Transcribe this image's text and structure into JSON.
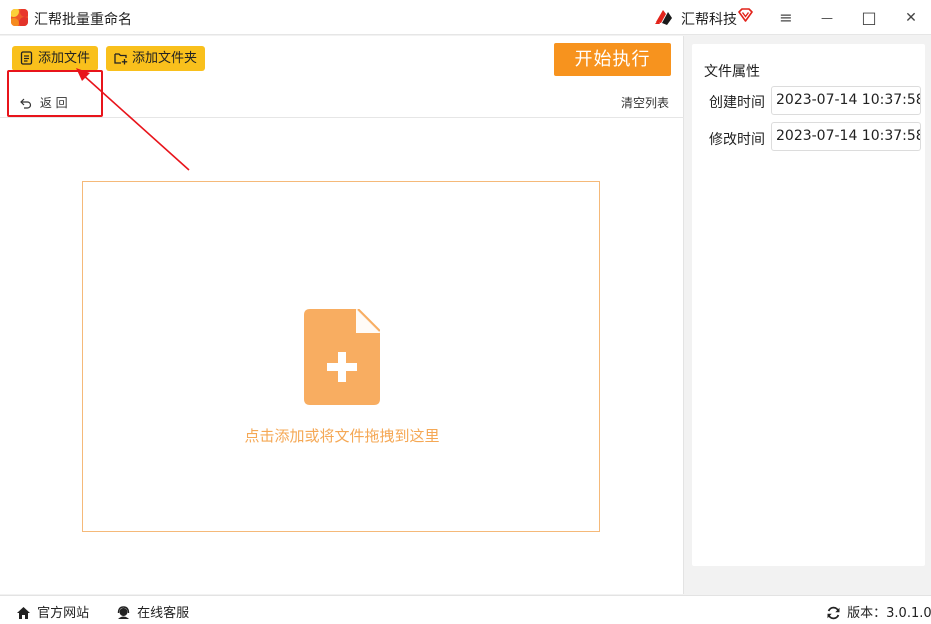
{
  "app": {
    "title": "汇帮批量重命名",
    "brand_name": "汇帮科技"
  },
  "icons": {
    "app_logo": "app-logo-icon",
    "brand_logo": "brand-logo-icon",
    "vip": "vip-diamond-icon",
    "menu": "hamburger-menu-icon",
    "minimize": "minimize-icon",
    "maximize": "maximize-icon",
    "close": "close-icon"
  },
  "window_controls": {
    "menu": "≡",
    "minimize": "—",
    "maximize": "□",
    "close": "✕"
  },
  "toolbar": {
    "add_file_label": "添加文件",
    "add_folder_label": "添加文件夹",
    "start_label": "开始执行",
    "back_label": "返 回",
    "clear_label": "清空列表"
  },
  "dropzone": {
    "text": "点击添加或将文件拖拽到这里"
  },
  "properties": {
    "title": "文件属性",
    "created_label": "创建时间",
    "created_value": "2023-07-14 10:37:58",
    "modified_label": "修改时间",
    "modified_value": "2023-07-14 10:37:58"
  },
  "footer": {
    "website_label": "官方网站",
    "support_label": "在线客服",
    "version_label": "版本：3.0.1.0"
  },
  "colors": {
    "accent_yellow": "#f9c01c",
    "accent_orange": "#f7931e",
    "drop_icon": "#f8ad61",
    "highlight_red": "#e8141b"
  }
}
